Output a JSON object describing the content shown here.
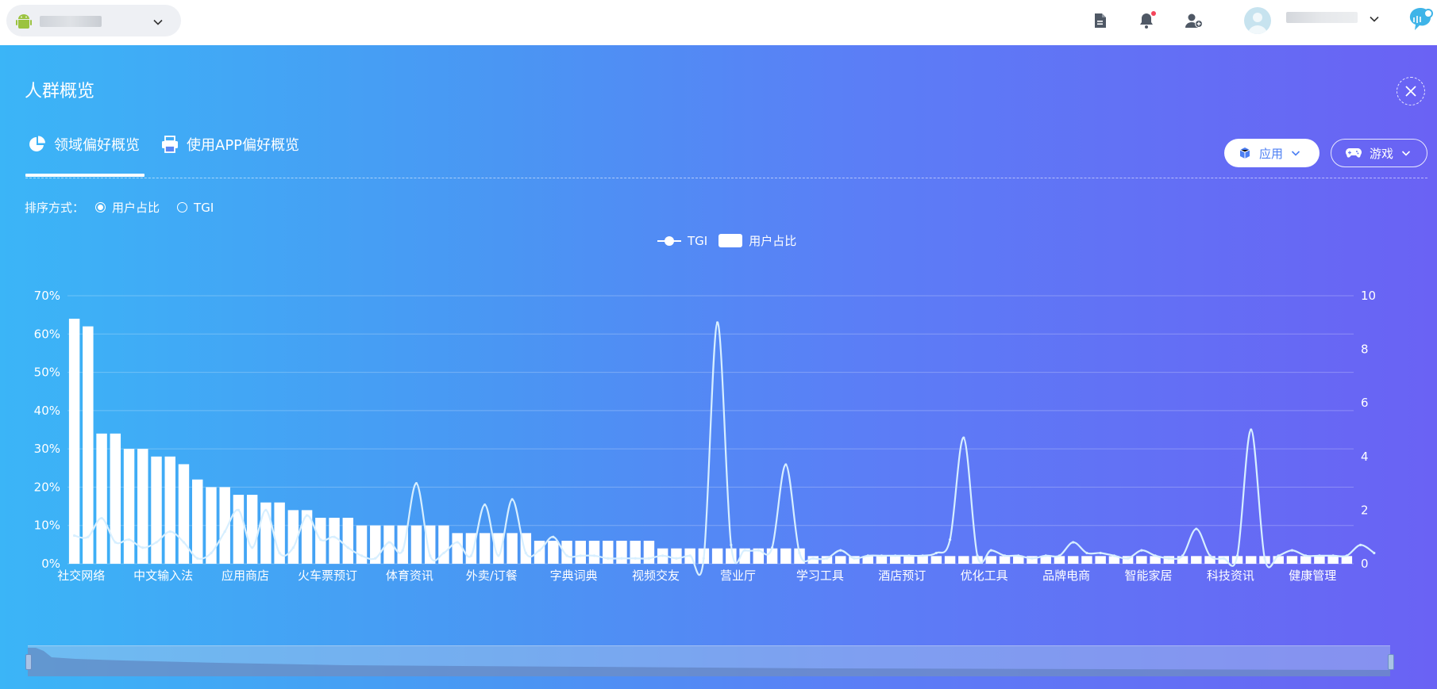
{
  "topbar": {
    "icons": [
      "android-icon",
      "chevron-down-icon",
      "document-icon",
      "bell-icon",
      "add-user-icon",
      "avatar",
      "chevron-down-icon",
      "brand-logo"
    ]
  },
  "panel": {
    "title": "人群概览",
    "tabs": [
      {
        "label": "领域偏好概览",
        "icon": "pie-chart-icon",
        "active": true
      },
      {
        "label": "使用APP偏好概览",
        "icon": "printer-icon",
        "active": false
      }
    ],
    "filters": {
      "app": "应用",
      "game": "游戏"
    },
    "sort": {
      "label": "排序方式：",
      "options": [
        "用户占比",
        "TGI"
      ],
      "selected": "用户占比"
    }
  },
  "colors": {
    "gradient_start": "#3bb5f7",
    "gradient_end": "#6a62f4",
    "bar": "#ffffff",
    "line": "#d7efff"
  },
  "chart_data": {
    "type": "bar",
    "legend": [
      "TGI",
      "用户占比"
    ],
    "legend_position": "top-center",
    "grid": true,
    "y_left": {
      "ticks": [
        "70%",
        "60%",
        "50%",
        "40%",
        "30%",
        "20%",
        "10%",
        "0%"
      ],
      "range": [
        0,
        70
      ]
    },
    "y_right": {
      "ticks": [
        "10",
        "8",
        "6",
        "4",
        "2",
        "0"
      ],
      "range": [
        0,
        10
      ]
    },
    "x_labels": [
      "社交网络",
      "中文输入法",
      "应用商店",
      "火车票预订",
      "体育资讯",
      "外卖/订餐",
      "字典词典",
      "视频交友",
      "营业厅",
      "学习工具",
      "酒店预订",
      "优化工具",
      "品牌电商",
      "智能家居",
      "科技资讯",
      "健康管理"
    ],
    "series": [
      {
        "name": "用户占比",
        "type": "bar",
        "values": [
          64,
          62,
          34,
          34,
          30,
          30,
          28,
          28,
          26,
          22,
          20,
          20,
          18,
          18,
          16,
          16,
          14,
          14,
          12,
          12,
          12,
          10,
          10,
          10,
          10,
          10,
          10,
          10,
          8,
          8,
          8,
          8,
          8,
          8,
          6,
          6,
          6,
          6,
          6,
          6,
          6,
          6,
          6,
          4,
          4,
          4,
          4,
          4,
          4,
          4,
          4,
          4,
          4,
          4,
          2,
          2,
          2,
          2,
          2,
          2,
          2,
          2,
          2,
          2,
          2,
          2,
          2,
          2,
          2,
          2,
          2,
          2,
          2,
          2,
          2,
          2,
          2,
          2,
          2,
          2,
          2,
          2,
          2,
          2,
          2,
          2,
          2,
          2,
          2,
          2,
          2,
          2,
          2,
          2
        ]
      },
      {
        "name": "TGI",
        "type": "line",
        "values": [
          1.05,
          1.0,
          1.7,
          0.8,
          0.9,
          0.6,
          0.8,
          1.2,
          0.8,
          0.2,
          0.4,
          1.2,
          2.0,
          0.6,
          2.0,
          0.4,
          0.6,
          1.8,
          0.9,
          1.0,
          0.6,
          0.3,
          0.2,
          0.8,
          0.5,
          3.0,
          0.3,
          0.4,
          0.8,
          0.3,
          2.2,
          0.3,
          2.4,
          0.4,
          0.5,
          1.0,
          0.3,
          0.3,
          0.3,
          0.2,
          0.2,
          0.2,
          0.2,
          0.3,
          0.2,
          0.3,
          0.2,
          9.0,
          0.7,
          0.5,
          0.5,
          0.6,
          3.7,
          0.4,
          0.2,
          0.2,
          0.5,
          0.2,
          0.3,
          0.3,
          0.3,
          0.3,
          0.3,
          0.4,
          0.9,
          4.7,
          0.3,
          0.5,
          0.3,
          0.3,
          0.2,
          0.3,
          0.3,
          0.8,
          0.4,
          0.4,
          0.3,
          0.2,
          0.5,
          0.3,
          0.2,
          0.3,
          1.3,
          0.3,
          0.2,
          0.3,
          5.0,
          0.2,
          0.3,
          0.5,
          0.3,
          0.3,
          0.3,
          0.3,
          0.7,
          0.4
        ]
      }
    ]
  }
}
